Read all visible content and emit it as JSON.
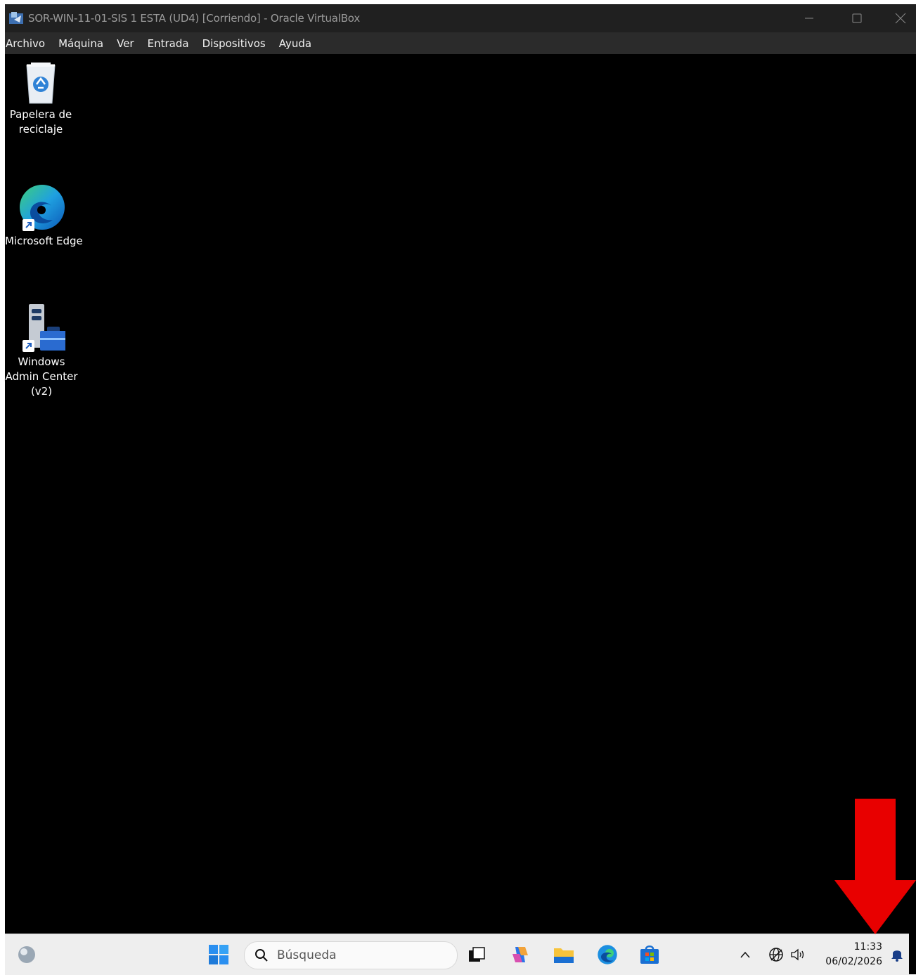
{
  "window": {
    "title": "SOR-WIN-11-01-SIS 1  ESTA (UD4) [Corriendo] - Oracle VirtualBox"
  },
  "menu": [
    "Archivo",
    "Máquina",
    "Ver",
    "Entrada",
    "Dispositivos",
    "Ayuda"
  ],
  "desktop_icons": [
    {
      "label": "Papelera de reciclaje",
      "icon": "recycle-bin-icon"
    },
    {
      "label": "Microsoft Edge",
      "icon": "edge-icon"
    },
    {
      "label": "Windows Admin Center (v2)",
      "icon": "admin-center-icon"
    }
  ],
  "taskbar": {
    "search_placeholder": "Búsqueda",
    "time": "11:33",
    "date": "06/02/2026",
    "apps": [
      "start-icon",
      "task-view-icon",
      "copilot-icon",
      "file-explorer-icon",
      "edge-icon",
      "store-icon"
    ],
    "tray": [
      "chevron-up-icon",
      "network-icon",
      "volume-icon",
      "bell-icon"
    ]
  },
  "annotation": {
    "color": "#e80000",
    "icon": "red-down-arrow"
  }
}
